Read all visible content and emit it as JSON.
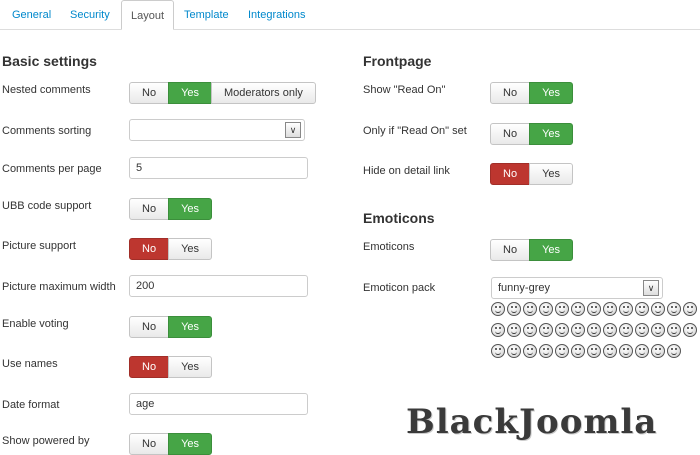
{
  "tabs": [
    "General",
    "Security",
    "Layout",
    "Template",
    "Integrations"
  ],
  "left": {
    "heading": "Basic settings",
    "nested_comments": {
      "label": "Nested comments",
      "options": [
        "No",
        "Yes",
        "Moderators only"
      ],
      "selected": "Yes"
    },
    "comments_sorting": {
      "label": "Comments sorting",
      "value": ""
    },
    "comments_per_page": {
      "label": "Comments per page",
      "value": "5"
    },
    "ubb_code": {
      "label": "UBB code support",
      "options": [
        "No",
        "Yes"
      ],
      "selected": "Yes"
    },
    "picture_support": {
      "label": "Picture support",
      "options": [
        "No",
        "Yes"
      ],
      "selected": "No"
    },
    "picture_max_width": {
      "label": "Picture maximum width",
      "value": "200"
    },
    "enable_voting": {
      "label": "Enable voting",
      "options": [
        "No",
        "Yes"
      ],
      "selected": "Yes"
    },
    "use_names": {
      "label": "Use names",
      "options": [
        "No",
        "Yes"
      ],
      "selected": "No"
    },
    "date_format": {
      "label": "Date format",
      "value": "age"
    },
    "show_powered_by": {
      "label": "Show powered by",
      "options": [
        "No",
        "Yes"
      ],
      "selected": "Yes"
    }
  },
  "right": {
    "frontpage_heading": "Frontpage",
    "show_read_on": {
      "label": "Show \"Read On\"",
      "options": [
        "No",
        "Yes"
      ],
      "selected": "Yes"
    },
    "only_if_read_on": {
      "label": "Only if \"Read On\" set",
      "options": [
        "No",
        "Yes"
      ],
      "selected": "Yes"
    },
    "hide_on_detail": {
      "label": "Hide on detail link",
      "options": [
        "No",
        "Yes"
      ],
      "selected": "No"
    },
    "emoticons_heading": "Emoticons",
    "emoticons": {
      "label": "Emoticons",
      "options": [
        "No",
        "Yes"
      ],
      "selected": "Yes"
    },
    "emoticon_pack": {
      "label": "Emoticon pack",
      "value": "funny-grey"
    },
    "emoticon_count": 38
  },
  "watermark": "BlackJoomla",
  "colors": {
    "green": "#46a546",
    "red": "#bd362f",
    "link": "#0088cc"
  }
}
